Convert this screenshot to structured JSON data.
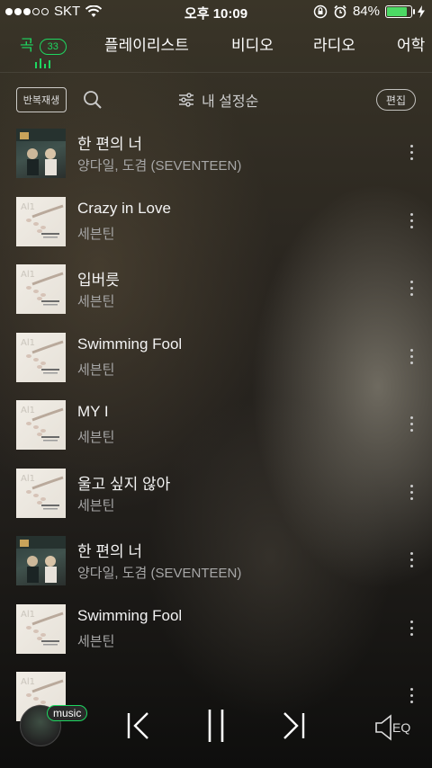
{
  "status_bar": {
    "carrier": "SKT",
    "time": "오후 10:09",
    "battery": "84%",
    "battery_level": 0.84
  },
  "tabs": [
    {
      "label": "곡",
      "count": "33",
      "active": true
    },
    {
      "label": "플레이리스트"
    },
    {
      "label": "비디오"
    },
    {
      "label": "라디오"
    },
    {
      "label": "어학"
    }
  ],
  "toolbar": {
    "repeat_label": "반복재생",
    "sort_label": "내 설정순",
    "edit_label": "편집"
  },
  "songs": [
    {
      "title": "한 편의 너",
      "artist": "양다일, 도겸 (SEVENTEEN)",
      "art": "dark"
    },
    {
      "title": "Crazy in Love",
      "artist": "세븐틴",
      "art": "light"
    },
    {
      "title": "입버릇",
      "artist": "세븐틴",
      "art": "light"
    },
    {
      "title": "Swimming Fool",
      "artist": "세븐틴",
      "art": "light"
    },
    {
      "title": "MY I",
      "artist": "세븐틴",
      "art": "light"
    },
    {
      "title": "울고 싶지 않아",
      "artist": "세븐틴",
      "art": "light"
    },
    {
      "title": "한 편의 너",
      "artist": "양다일, 도겸 (SEVENTEEN)",
      "art": "dark"
    },
    {
      "title": "Swimming Fool",
      "artist": "세븐틴",
      "art": "light"
    },
    {
      "title": "",
      "artist": "",
      "art": "light"
    }
  ],
  "player": {
    "tag": "music",
    "eq_label": "EQ"
  },
  "colors": {
    "accent": "#1ed760"
  }
}
